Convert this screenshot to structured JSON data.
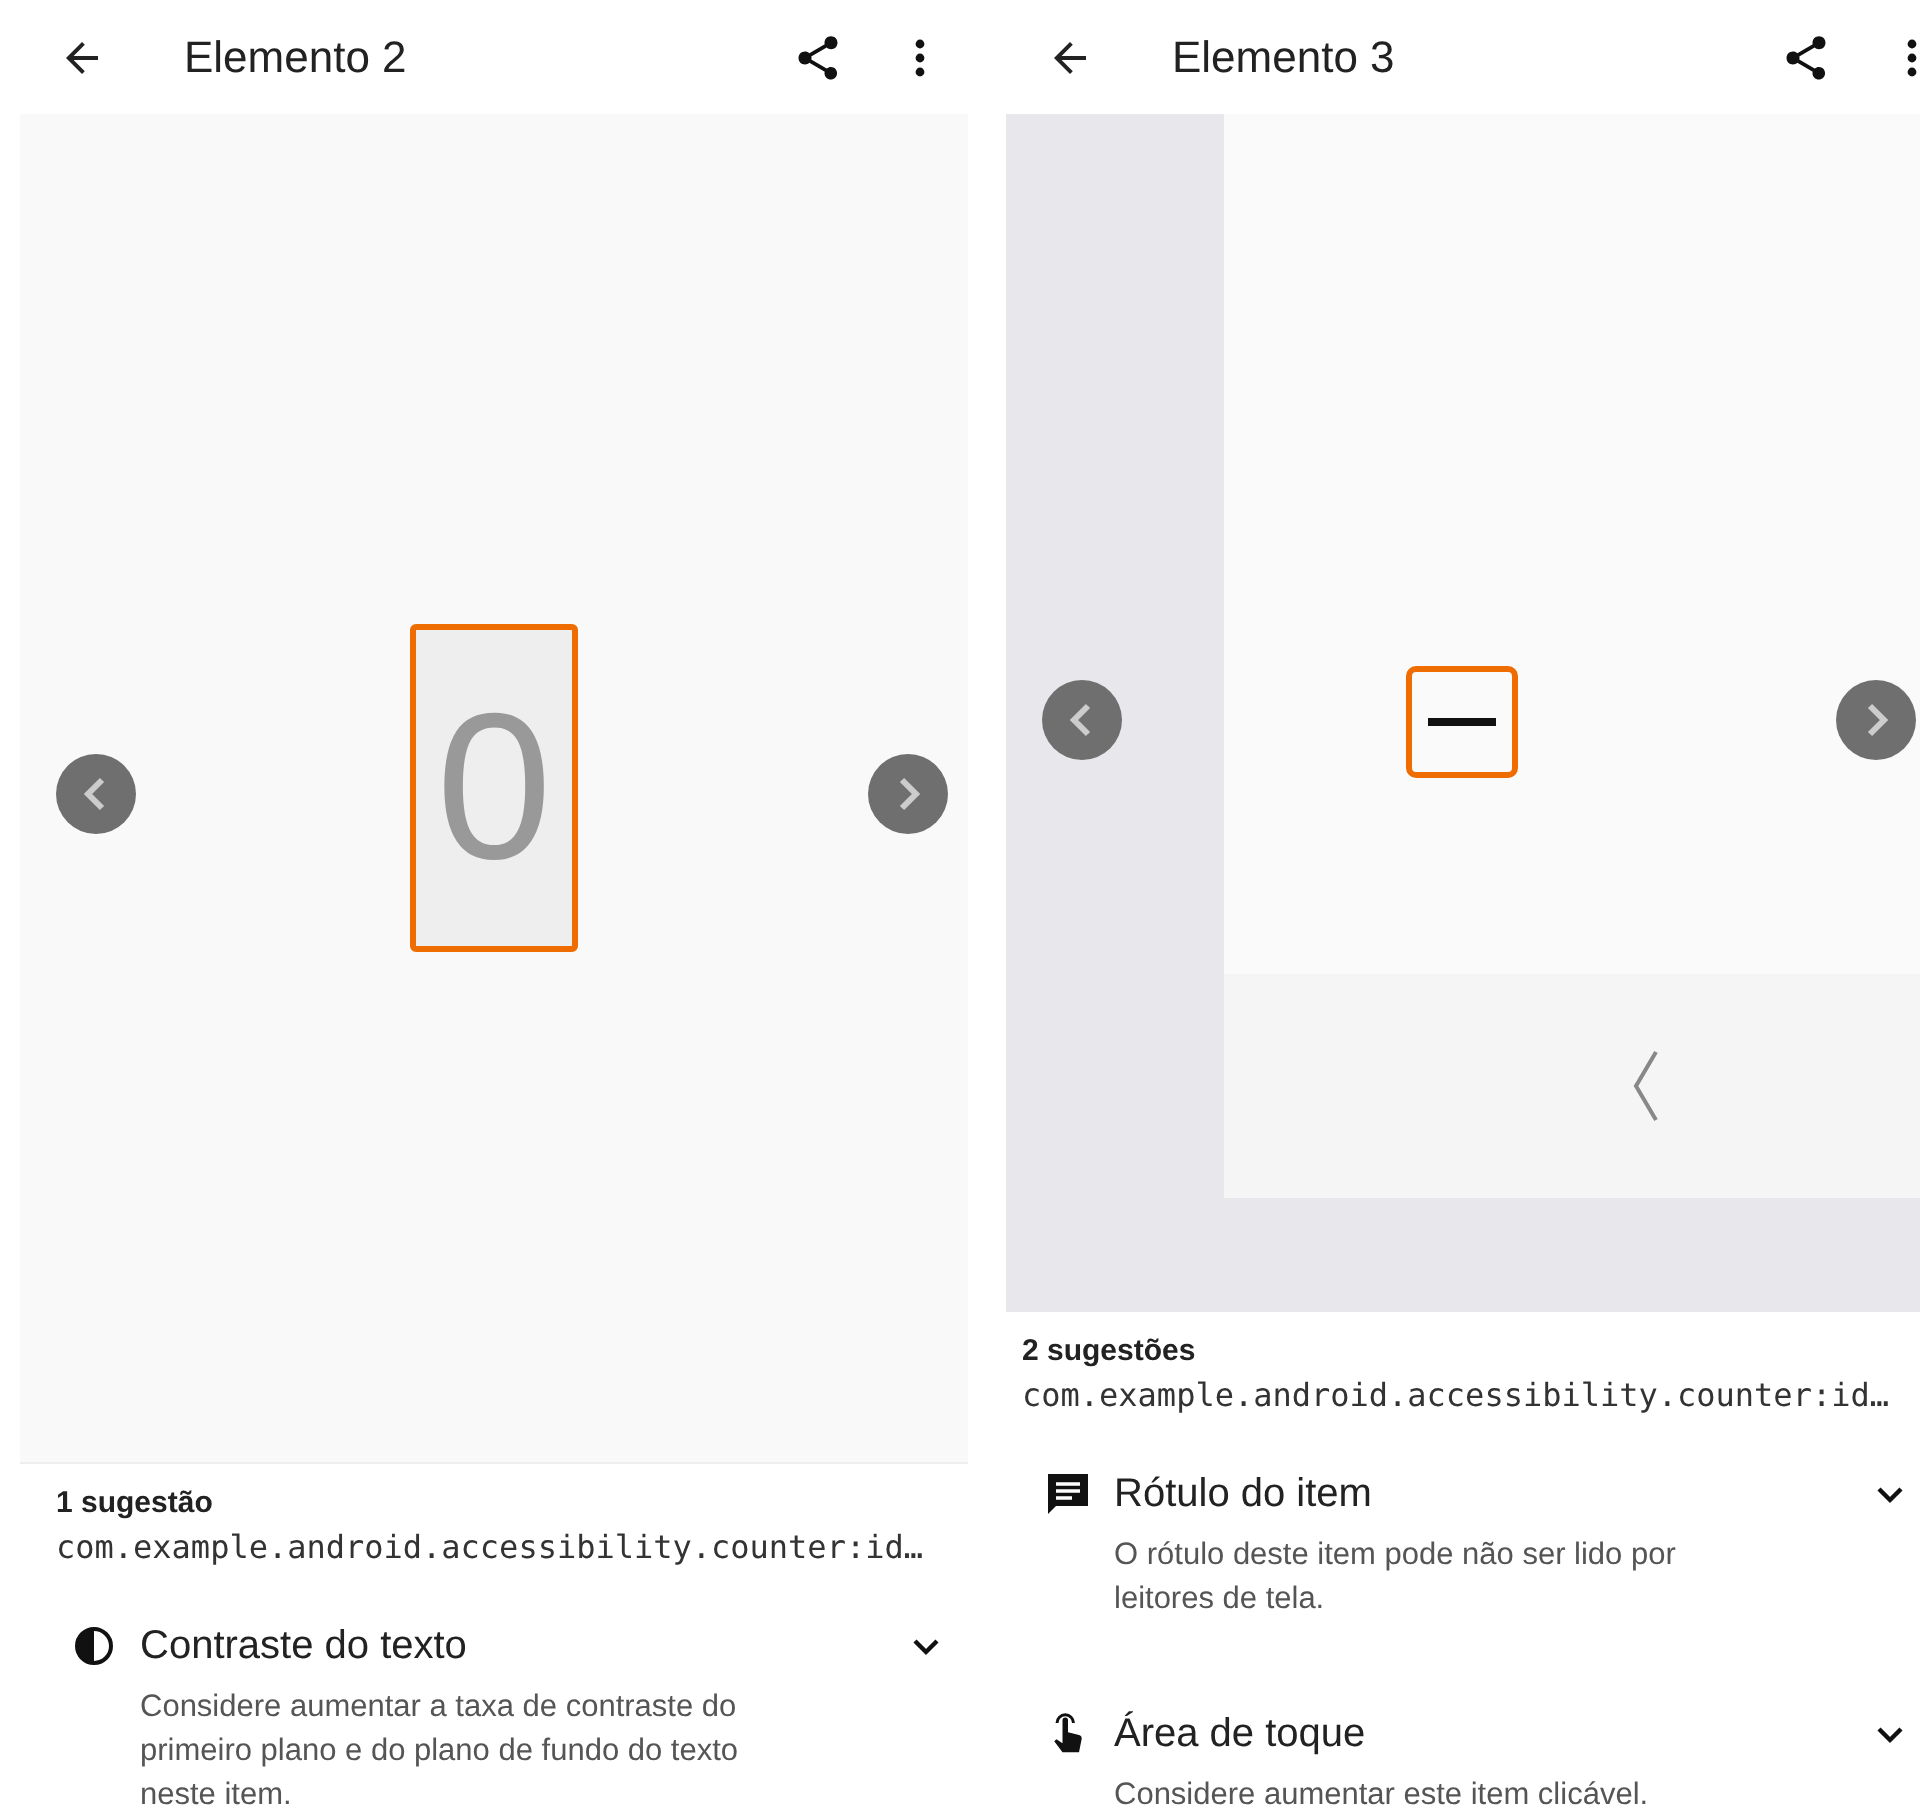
{
  "screens": [
    {
      "title": "Elemento 2",
      "preview": {
        "kind": "digit",
        "text": "0"
      },
      "count": "1 sugestão",
      "element_id": "com.example.android.accessibility.counter:id…",
      "suggestions": [
        {
          "kind": "contrast",
          "title": "Contraste do texto",
          "description": "Considere aumentar a taxa de contraste do primeiro plano e do plano de fundo do texto neste item."
        }
      ]
    },
    {
      "title": "Elemento 3",
      "preview": {
        "kind": "minus"
      },
      "count": "2 sugestões",
      "element_id": "com.example.android.accessibility.counter:id…",
      "suggestions": [
        {
          "kind": "label",
          "title": "Rótulo do item",
          "description": "O rótulo deste item pode não ser lido por leitores de tela."
        },
        {
          "kind": "touch",
          "title": "Área de toque",
          "description": "Considere aumentar este item clicável."
        }
      ]
    }
  ]
}
